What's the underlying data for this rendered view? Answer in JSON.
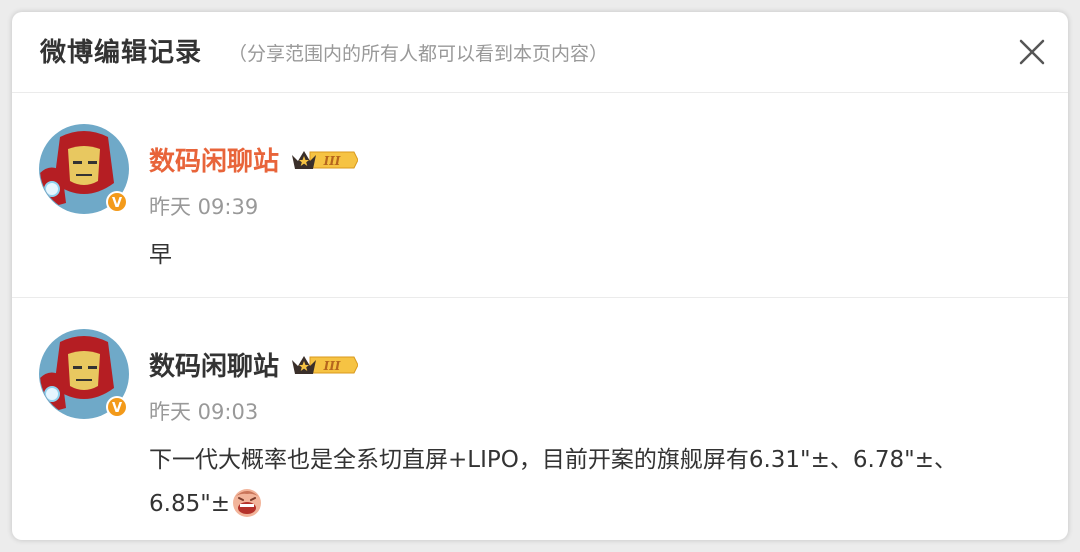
{
  "dialog": {
    "title": "微博编辑记录",
    "subtitle": "（分享范围内的所有人都可以看到本页内容）",
    "close_icon": "close-icon"
  },
  "posts": [
    {
      "author": "数码闲聊站",
      "author_color": "#e8643a",
      "badge_level": "III",
      "time": "昨天 09:39",
      "content": "早"
    },
    {
      "author": "数码闲聊站",
      "author_color": "#333333",
      "badge_level": "III",
      "time": "昨天 09:03",
      "content": "下一代大概率也是全系切直屏+LIPO，目前开案的旗舰屏有6.31\"±、6.78\"±、6.85\"±",
      "emoji": "laughing-emoji"
    }
  ]
}
